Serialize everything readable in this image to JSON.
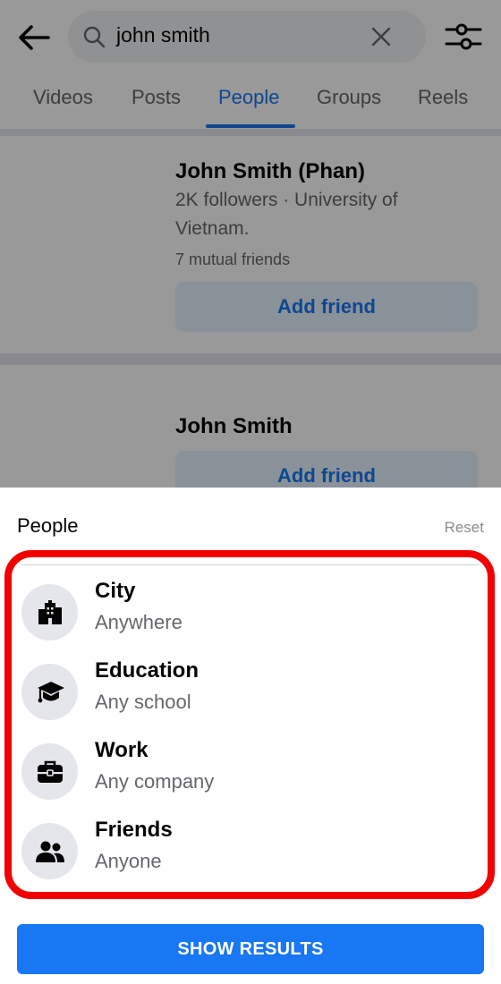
{
  "search": {
    "query": "john smith"
  },
  "tabs": [
    {
      "label": "Videos",
      "active": false
    },
    {
      "label": "Posts",
      "active": false
    },
    {
      "label": "People",
      "active": true
    },
    {
      "label": "Groups",
      "active": false
    },
    {
      "label": "Reels",
      "active": false
    }
  ],
  "results": [
    {
      "name": "John Smith (Phan)",
      "meta": "2K followers · University of Vietnam.",
      "mutual": "7 mutual friends",
      "action": "Add friend"
    },
    {
      "name": "John Smith",
      "action": "Add friend"
    }
  ],
  "sheet": {
    "title": "People",
    "reset_label": "Reset",
    "options": [
      {
        "label": "City",
        "value": "Anywhere",
        "icon": "city-icon"
      },
      {
        "label": "Education",
        "value": "Any school",
        "icon": "graduation-cap-icon"
      },
      {
        "label": "Work",
        "value": "Any company",
        "icon": "briefcase-icon"
      },
      {
        "label": "Friends",
        "value": "Anyone",
        "icon": "friends-icon"
      }
    ],
    "submit_label": "SHOW RESULTS"
  },
  "colors": {
    "accent": "#1877f2",
    "highlight": "#f20000",
    "icon_bg": "#e4e6eb",
    "secondary_text": "#65676b"
  }
}
